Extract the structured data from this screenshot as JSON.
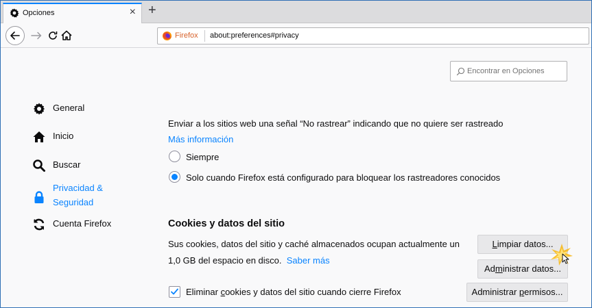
{
  "tab": {
    "label": "Opciones",
    "close": "×",
    "new_tab": "+"
  },
  "urlbar": {
    "identity": "Firefox",
    "url": "about:preferences#privacy"
  },
  "search": {
    "placeholder": "Encontrar en Opciones"
  },
  "sidebar": {
    "items": [
      {
        "label": "General",
        "icon": "gear-icon"
      },
      {
        "label": "Inicio",
        "icon": "home-icon"
      },
      {
        "label": "Buscar",
        "icon": "search-icon"
      },
      {
        "label_line1": "Privacidad &",
        "label_line2": "Seguridad",
        "icon": "lock-icon",
        "active": true
      },
      {
        "label": "Cuenta Firefox",
        "icon": "sync-icon"
      }
    ]
  },
  "dnt": {
    "text": "Enviar a los sitios web una señal “No rastrear” indicando que no quiere ser rastreado",
    "more_info": "Más información",
    "options": [
      {
        "label": "Siempre",
        "selected": false
      },
      {
        "label": "Solo cuando Firefox está configurado para bloquear los rastreadores conocidos",
        "selected": true
      }
    ]
  },
  "cookies": {
    "title": "Cookies y datos del sitio",
    "desc_line1": "Sus cookies, datos del sitio y caché almacenados ocupan actualmente un",
    "desc_line2": "1,0 GB del espacio en disco.",
    "learn_more": "Saber más",
    "clear_button": {
      "pre": "",
      "accel": "L",
      "post": "impiar datos..."
    },
    "manage_button": {
      "pre": "Ad",
      "accel": "m",
      "post": "inistrar datos..."
    },
    "permissions_button": {
      "pre": "Administrar ",
      "accel": "p",
      "post": "ermisos..."
    },
    "delete_on_close": {
      "pre": "Eliminar ",
      "accel": "c",
      "post": "ookies y datos del sitio cuando cierre Firefox",
      "checked": true
    }
  },
  "colors": {
    "accent": "#0a84ff",
    "firefox_orange": "#d7612a"
  }
}
